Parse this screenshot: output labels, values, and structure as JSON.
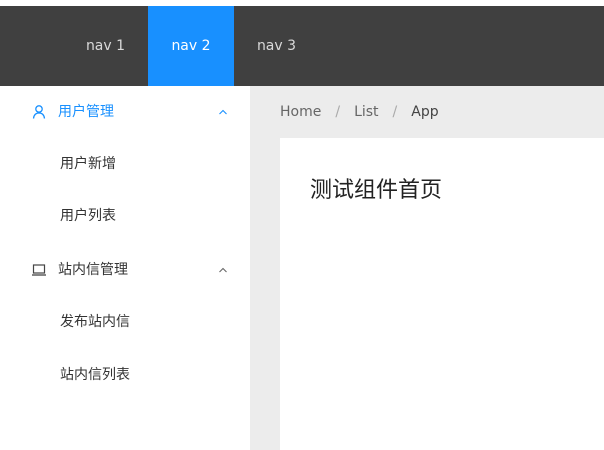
{
  "topnav": {
    "items": [
      {
        "label": "nav 1"
      },
      {
        "label": "nav 2"
      },
      {
        "label": "nav 3"
      }
    ],
    "active_index": 1,
    "active_color": "#1890ff",
    "background": "#404040"
  },
  "sidebar": {
    "groups": [
      {
        "title": "用户管理",
        "icon": "user-icon",
        "expanded": true,
        "items": [
          {
            "label": "用户新增"
          },
          {
            "label": "用户列表"
          }
        ]
      },
      {
        "title": "站内信管理",
        "icon": "laptop-icon",
        "expanded": true,
        "items": [
          {
            "label": "发布站内信"
          },
          {
            "label": "站内信列表"
          }
        ]
      }
    ]
  },
  "breadcrumb": {
    "items": [
      {
        "label": "Home"
      },
      {
        "label": "List"
      },
      {
        "label": "App"
      }
    ],
    "separator": "/"
  },
  "content": {
    "title": "测试组件首页"
  }
}
